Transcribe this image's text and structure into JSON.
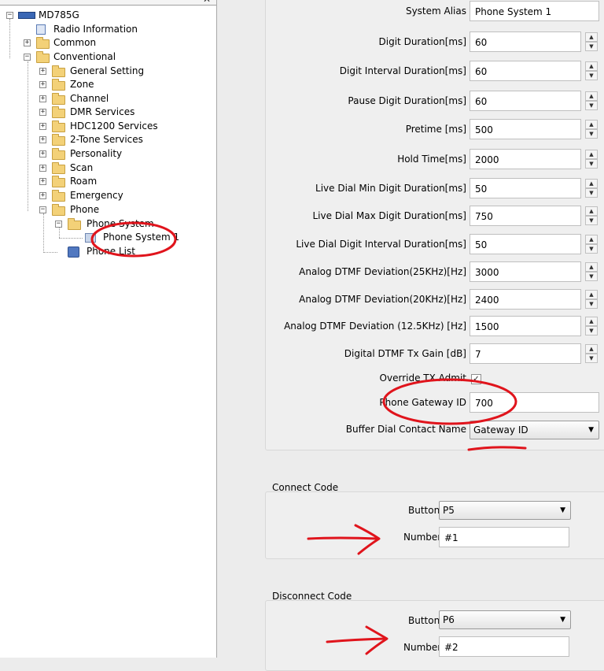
{
  "tree": {
    "root": "MD785G",
    "items": [
      {
        "label": "Radio Information"
      },
      {
        "label": "Common"
      },
      {
        "label": "Conventional"
      },
      {
        "label": "General Setting"
      },
      {
        "label": "Zone"
      },
      {
        "label": "Channel"
      },
      {
        "label": "DMR Services"
      },
      {
        "label": "HDC1200 Services"
      },
      {
        "label": "2-Tone Services"
      },
      {
        "label": "Personality"
      },
      {
        "label": "Scan"
      },
      {
        "label": "Roam"
      },
      {
        "label": "Emergency"
      },
      {
        "label": "Phone"
      },
      {
        "label": "Phone System"
      },
      {
        "label": "Phone System 1"
      },
      {
        "label": "Phone List"
      }
    ]
  },
  "form": {
    "system_alias": {
      "label": "System Alias",
      "value": "Phone System 1"
    },
    "digit_duration": {
      "label": "Digit Duration[ms]",
      "value": "60"
    },
    "digit_interval": {
      "label": "Digit Interval Duration[ms]",
      "value": "60"
    },
    "pause_digit": {
      "label": "Pause Digit Duration[ms]",
      "value": "60"
    },
    "pretime": {
      "label": "Pretime [ms]",
      "value": "500"
    },
    "hold_time": {
      "label": "Hold Time[ms]",
      "value": "2000"
    },
    "live_min": {
      "label": "Live Dial Min Digit Duration[ms]",
      "value": "50"
    },
    "live_max": {
      "label": "Live Dial Max Digit Duration[ms]",
      "value": "750"
    },
    "live_interval": {
      "label": "Live Dial Digit Interval Duration[ms]",
      "value": "50"
    },
    "dtmf_25": {
      "label": "Analog DTMF Deviation(25KHz)[Hz]",
      "value": "3000"
    },
    "dtmf_20": {
      "label": "Analog DTMF Deviation(20KHz)[Hz]",
      "value": "2400"
    },
    "dtmf_125": {
      "label": "Analog DTMF Deviation (12.5KHz) [Hz]",
      "value": "1500"
    },
    "digital_gain": {
      "label": "Digital DTMF Tx Gain [dB]",
      "value": "7"
    },
    "override_tx": {
      "label": "Override TX Admit",
      "checked": true
    },
    "gateway_id": {
      "label": "Phone Gateway ID",
      "value": "700"
    },
    "buffer_dial": {
      "label": "Buffer Dial Contact Name",
      "value": "Gateway ID"
    }
  },
  "connect": {
    "title": "Connect Code",
    "button_label": "Button",
    "button_value": "P5",
    "number_label": "Number",
    "number_value": "#1"
  },
  "disconnect": {
    "title": "Disconnect Code",
    "button_label": "Button",
    "button_value": "P6",
    "number_label": "Number",
    "number_value": "#2"
  },
  "colors": {
    "annotation": "#e0141c",
    "folder": "#f3d178"
  }
}
